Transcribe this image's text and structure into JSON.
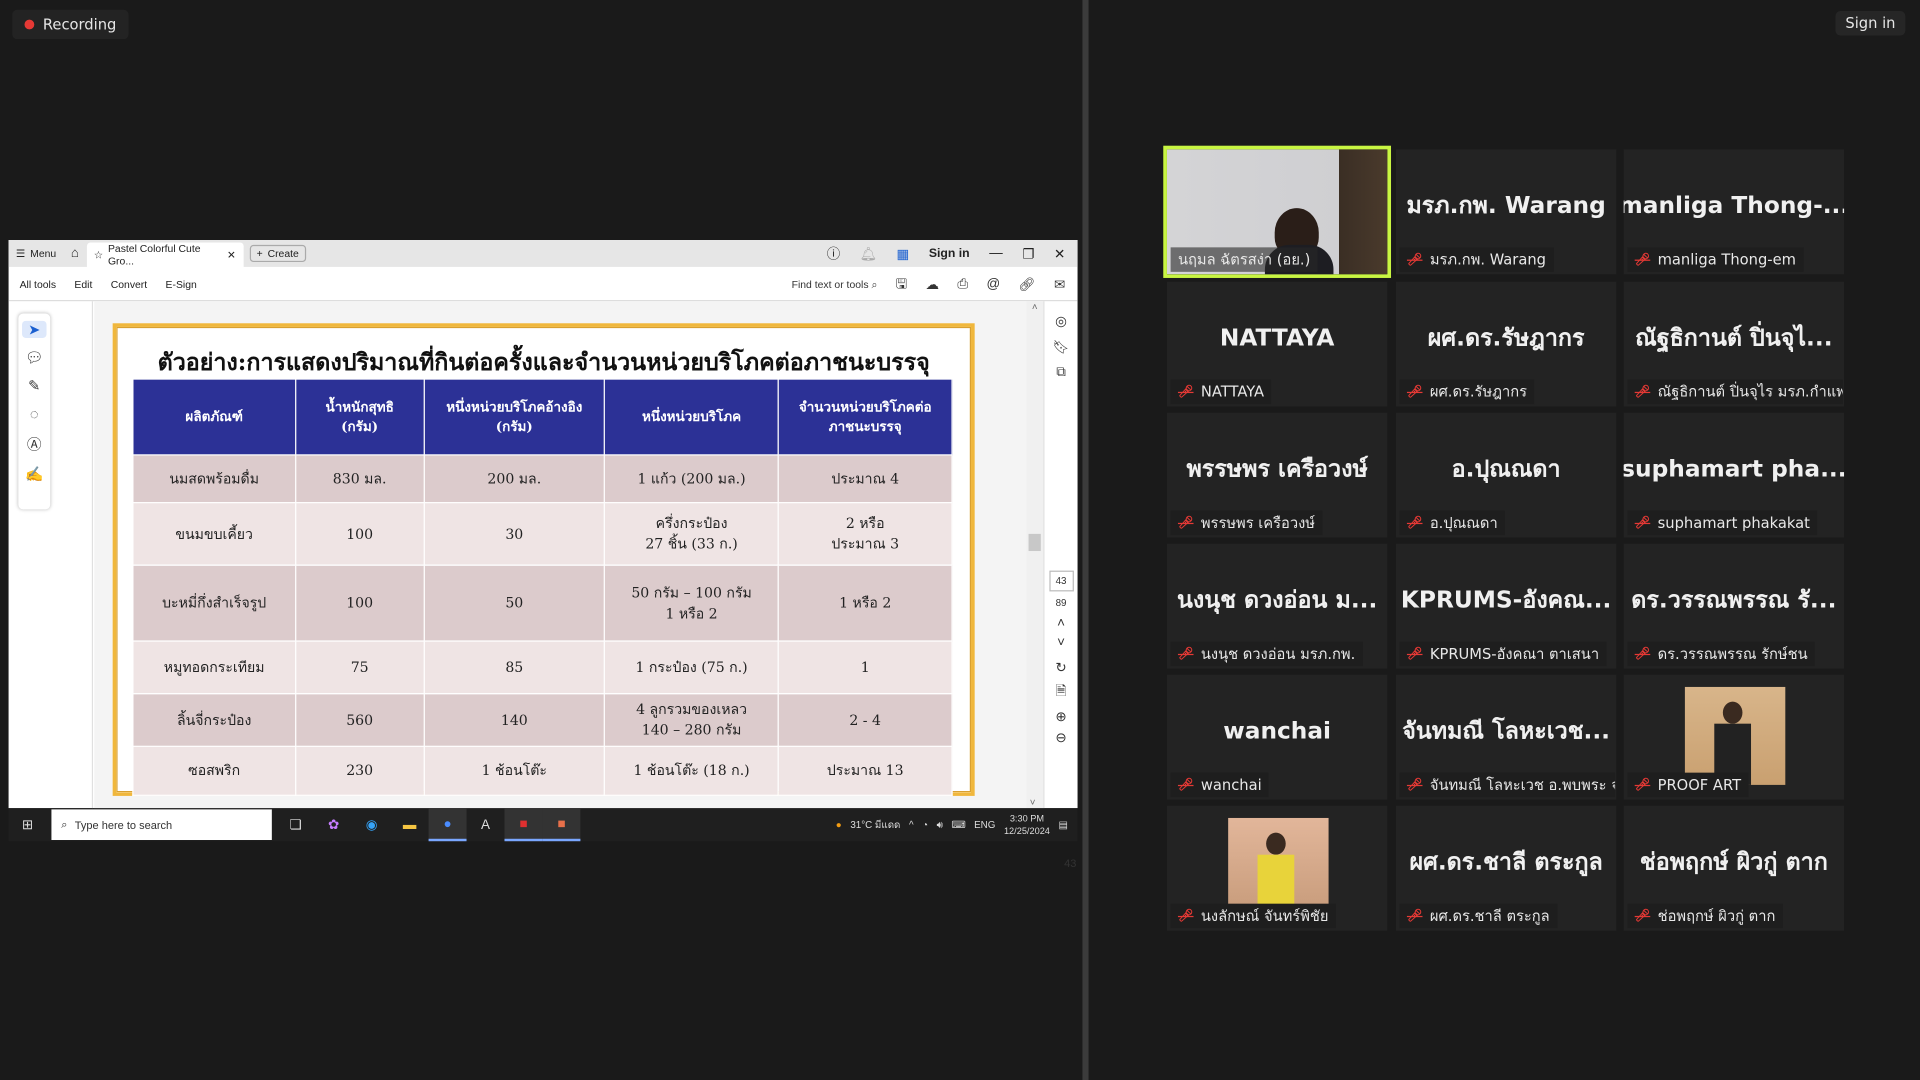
{
  "zoom": {
    "recording_label": "Recording",
    "sign_in": "Sign in"
  },
  "acrobat": {
    "menu": "Menu",
    "tab_title": "Pastel Colorful Cute Gro...",
    "create": "Create",
    "sign_in": "Sign in",
    "toolbar": [
      "All tools",
      "Edit",
      "Convert",
      "E-Sign"
    ],
    "find": "Find text or tools",
    "page_current": "43",
    "page_total": "89",
    "page_footer": "43"
  },
  "document": {
    "title": "ตัวอย่าง:การแสดงปริมาณที่กินต่อครั้งและจำนวนหน่วยบริโภคต่อภาชนะบรรจุ",
    "headers": [
      "ผลิตภัณฑ์",
      "น้ำหนักสุทธิ\n(กรัม)",
      "หนึ่งหน่วยบริโภคอ้างอิง\n(กรัม)",
      "หนึ่งหน่วยบริโภค",
      "จำนวนหน่วยบริโภคต่อ\nภาชนะบรรจุ"
    ],
    "rows": [
      [
        "นมสดพร้อมดื่ม",
        "830 มล.",
        "200 มล.",
        "1 แก้ว (200 มล.)",
        "ประมาณ 4"
      ],
      [
        "ขนมขบเคี้ยว",
        "100",
        "30",
        "ครึ่งกระป๋อง\n27 ชิ้น (33 ก.)",
        "2 หรือ\nประมาณ 3"
      ],
      [
        "บะหมี่กึ่งสำเร็จรูป",
        "100",
        "50",
        "50 กรัม – 100 กรัม\n1 หรือ 2",
        "1 หรือ 2"
      ],
      [
        "หมูทอดกระเทียม",
        "75",
        "85",
        "1 กระป๋อง (75 ก.)",
        "1"
      ],
      [
        "ลิ้นจี่กระป๋อง",
        "560",
        "140",
        "4 ลูกรวมของเหลว\n140 – 280 กรัม",
        "2 - 4"
      ],
      [
        "ซอสพริก",
        "230",
        "1 ช้อนโต๊ะ",
        "1 ช้อนโต๊ะ (18 ก.)",
        "ประมาณ 13"
      ]
    ]
  },
  "taskbar": {
    "search_placeholder": "Type here to search",
    "weather": "31°C มีแดด",
    "lang": "ENG",
    "time": "3:30 PM",
    "date": "12/25/2024"
  },
  "participants": [
    {
      "big": "",
      "label": "นฤมล ฉัตรสง่า (อย.)",
      "media": "video",
      "active": true
    },
    {
      "big": "มรภ.กพ. Warang",
      "label": "มรภ.กพ. Warang"
    },
    {
      "big": "manliga Thong-...",
      "label": "manliga Thong-em"
    },
    {
      "big": "NATTAYA",
      "label": "NATTAYA"
    },
    {
      "big": "ผศ.ดร.รัษฎากร",
      "label": "ผศ.ดร.รัษฎากร"
    },
    {
      "big": "ณัฐธิกานต์ ปิ่นจุไ...",
      "label": "ณัฐธิกานต์ ปิ่นจุไร มรภ.กำแพ..."
    },
    {
      "big": "พรรษพร เครือวงษ์",
      "label": "พรรษพร เครือวงษ์"
    },
    {
      "big": "อ.ปุณณดา",
      "label": "อ.ปุณณดา"
    },
    {
      "big": "suphamart pha...",
      "label": "suphamart phakakat"
    },
    {
      "big": "นงนุช ดวงอ่อน ม...",
      "label": "นงนุช ดวงอ่อน มรภ.กพ."
    },
    {
      "big": "KPRUMS-อังคณ...",
      "label": "KPRUMS-อังคณา ตาเสนา"
    },
    {
      "big": "ดร.วรรณพรรณ รั...",
      "label": "ดร.วรรณพรรณ รักษ์ชน"
    },
    {
      "big": "wanchai",
      "label": "wanchai"
    },
    {
      "big": "จันทมณี โลหะเวช...",
      "label": "จันทมณี โลหะเวช อ.พบพระ จ...."
    },
    {
      "big": "",
      "label": "PROOF ART",
      "media": "photo"
    },
    {
      "big": "",
      "label": "นงลักษณ์ จันทร์พิชัย",
      "media": "photo"
    },
    {
      "big": "ผศ.ดร.ชาลี ตระกูล",
      "label": "ผศ.ดร.ชาลี ตระกูล"
    },
    {
      "big": "ช่อพฤกษ์ ผิวกู่ ตาก",
      "label": "ช่อพฤกษ์ ผิวกู่ ตาก"
    }
  ],
  "colors": {
    "table_header": "#2c3196",
    "row_dark": "#dccbcc",
    "row_light": "#efe4e4",
    "page_border": "#f0b73c",
    "active_speaker": "#c8f542",
    "muted_icon": "#e53935"
  }
}
